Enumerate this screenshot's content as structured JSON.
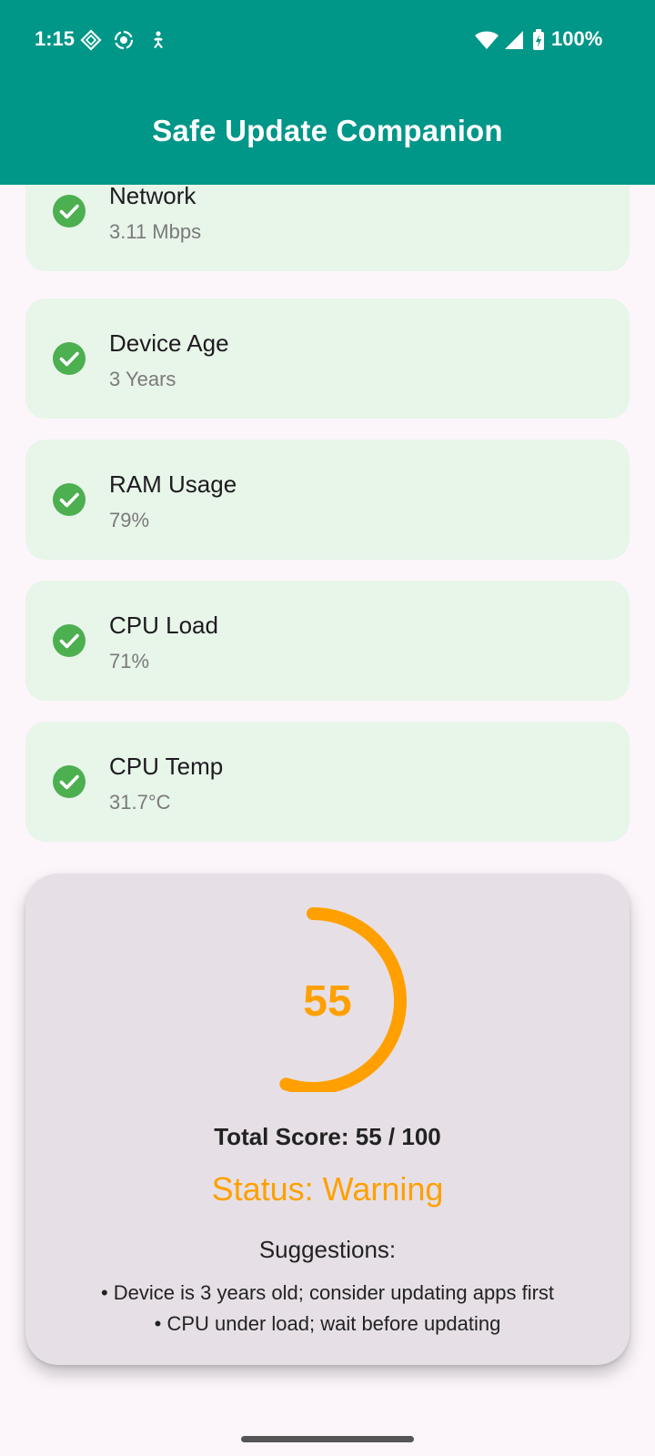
{
  "status_bar": {
    "time": "1:15",
    "battery": "100%",
    "icons": [
      "sim-diamond-icon",
      "record-circle-icon",
      "accessibility-icon",
      "wifi-icon",
      "cell-signal-icon",
      "battery-charging-icon"
    ]
  },
  "app_bar": {
    "title": "Safe Update Companion",
    "color": "#009688"
  },
  "metrics": [
    {
      "label": "Network",
      "value": "3.11 Mbps",
      "icon": "check-circle-icon"
    },
    {
      "label": "Device Age",
      "value": "3 Years",
      "icon": "check-circle-icon"
    },
    {
      "label": "RAM Usage",
      "value": "79%",
      "icon": "check-circle-icon"
    },
    {
      "label": "CPU Load",
      "value": "71%",
      "icon": "check-circle-icon"
    },
    {
      "label": "CPU Temp",
      "value": "31.7°C",
      "icon": "check-circle-icon"
    }
  ],
  "score": {
    "value": "55",
    "fraction": 0.55,
    "total_text": "Total Score: 55 / 100",
    "status_text": "Status: Warning",
    "status_color": "#FFA000",
    "suggestions_title": "Suggestions:",
    "suggestions": [
      "• Device is 3 years old; consider updating apps first",
      "• CPU under load; wait before updating"
    ]
  },
  "colors": {
    "card_bg": "#E8F5E9",
    "check": "#4CAF50",
    "score_card_bg": "#E6E0E6"
  }
}
